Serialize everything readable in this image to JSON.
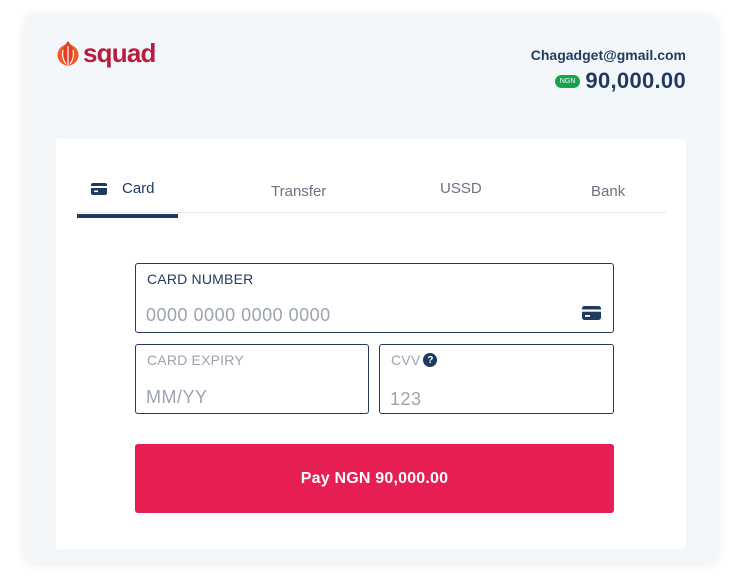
{
  "brand": {
    "name": "squad",
    "logo_icon": "flame-orb-icon",
    "color": "#b91c3c"
  },
  "account": {
    "email": "Chagadget@gmail.com",
    "currency_badge": "NGN",
    "amount": "90,000.00"
  },
  "tabs": [
    {
      "label": "Card",
      "icon": "card-icon",
      "active": true
    },
    {
      "label": "Transfer",
      "active": false
    },
    {
      "label": "USSD",
      "active": false
    },
    {
      "label": "Bank",
      "active": false
    }
  ],
  "form": {
    "card_number": {
      "label": "CARD NUMBER",
      "placeholder": "0000 0000 0000 0000",
      "value": "",
      "icon": "card-icon"
    },
    "card_expiry": {
      "label": "CARD EXPIRY",
      "placeholder": "MM/YY",
      "value": ""
    },
    "cvv": {
      "label": "CVV",
      "placeholder": "123",
      "value": "",
      "help_icon": "help-icon"
    }
  },
  "pay_button": {
    "label": "Pay NGN 90,000.00"
  },
  "colors": {
    "primary": "#1f3a5f",
    "accent": "#e61e52",
    "badge": "#16a34a",
    "background": "#f4f7f9"
  }
}
